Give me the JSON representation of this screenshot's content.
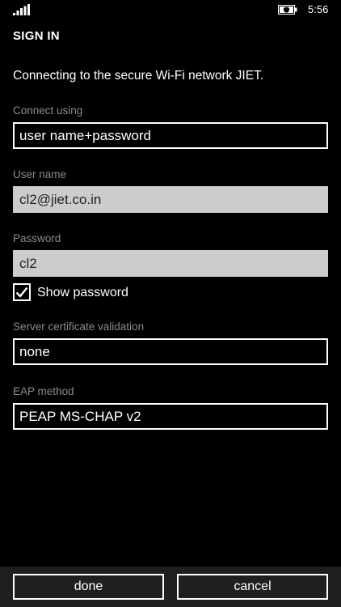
{
  "status_bar": {
    "time": "5:56",
    "signal_icon": "signal-bars-icon",
    "battery_icon": "battery-saver-icon"
  },
  "page": {
    "title": "SIGN IN",
    "intro": "Connecting to the secure Wi-Fi network JIET."
  },
  "form": {
    "connect_using": {
      "label": "Connect using",
      "value": "user name+password"
    },
    "user_name": {
      "label": "User name",
      "value": "cl2@jiet.co.in"
    },
    "password": {
      "label": "Password",
      "value": "cl2"
    },
    "show_password": {
      "label": "Show password",
      "checked": true
    },
    "server_cert": {
      "label": "Server certificate validation",
      "value": "none"
    },
    "eap_method": {
      "label": "EAP method",
      "value": "PEAP MS-CHAP v2"
    }
  },
  "app_bar": {
    "done_label": "done",
    "cancel_label": "cancel",
    "background": "#1f1f1f"
  }
}
